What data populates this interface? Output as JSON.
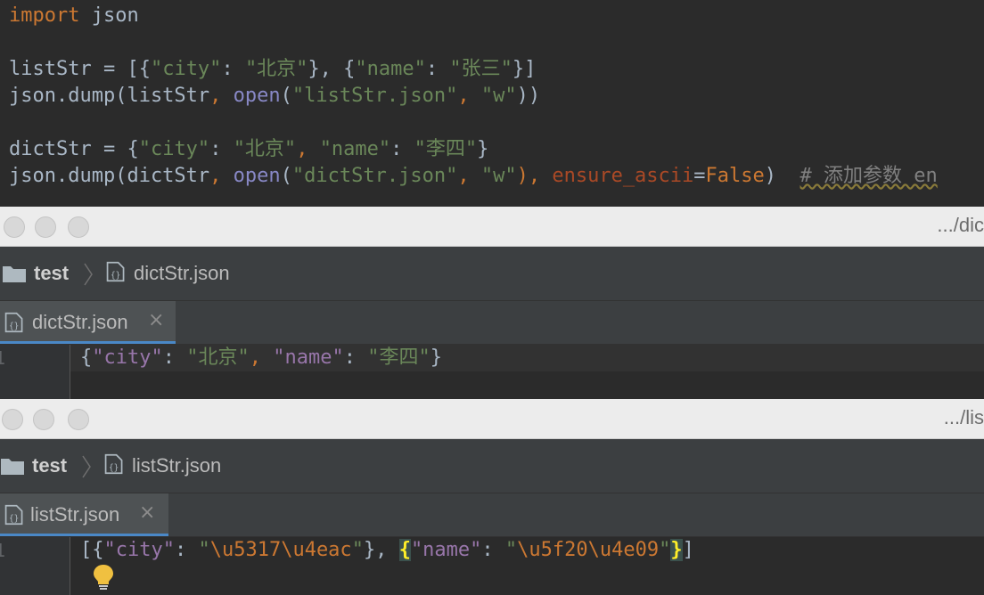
{
  "editor": {
    "lines": [
      [
        {
          "t": "import",
          "c": "kw"
        },
        {
          "t": " json",
          "c": "plain"
        }
      ],
      [],
      [
        {
          "t": "listStr = [{",
          "c": "plain"
        },
        {
          "t": "\"city\"",
          "c": "str"
        },
        {
          "t": ": ",
          "c": "plain"
        },
        {
          "t": "\"北京\"",
          "c": "str"
        },
        {
          "t": "}, {",
          "c": "plain"
        },
        {
          "t": "\"name\"",
          "c": "str"
        },
        {
          "t": ": ",
          "c": "plain"
        },
        {
          "t": "\"张三\"",
          "c": "str"
        },
        {
          "t": "}]",
          "c": "plain"
        }
      ],
      [
        {
          "t": "json.dump(listStr",
          "c": "plain"
        },
        {
          "t": ", ",
          "c": "kw"
        },
        {
          "t": "open",
          "c": "fn"
        },
        {
          "t": "(",
          "c": "plain"
        },
        {
          "t": "\"listStr.json\"",
          "c": "str"
        },
        {
          "t": ", ",
          "c": "kw"
        },
        {
          "t": "\"w\"",
          "c": "str"
        },
        {
          "t": "))",
          "c": "plain"
        }
      ],
      [],
      [
        {
          "t": "dictStr = {",
          "c": "plain"
        },
        {
          "t": "\"city\"",
          "c": "str"
        },
        {
          "t": ": ",
          "c": "plain"
        },
        {
          "t": "\"北京\"",
          "c": "str"
        },
        {
          "t": ", ",
          "c": "kw"
        },
        {
          "t": "\"name\"",
          "c": "str"
        },
        {
          "t": ": ",
          "c": "plain"
        },
        {
          "t": "\"李四\"",
          "c": "str"
        },
        {
          "t": "}",
          "c": "plain"
        }
      ],
      [
        {
          "t": "json.dump(dictStr",
          "c": "plain"
        },
        {
          "t": ", ",
          "c": "kw"
        },
        {
          "t": "open",
          "c": "fn"
        },
        {
          "t": "(",
          "c": "plain"
        },
        {
          "t": "\"dictStr.json\"",
          "c": "str"
        },
        {
          "t": ", ",
          "c": "kw"
        },
        {
          "t": "\"w\"",
          "c": "str"
        },
        {
          "t": "), ",
          "c": "kw"
        },
        {
          "t": "ensure_ascii",
          "c": "param"
        },
        {
          "t": "=",
          "c": "plain"
        },
        {
          "t": "False",
          "c": "kw"
        },
        {
          "t": ")  ",
          "c": "plain"
        },
        {
          "t": "# 添加参数 en",
          "c": "cmt squiggle"
        }
      ]
    ]
  },
  "window_dict": {
    "title_path": ".../dic",
    "nav_folder": "test",
    "nav_file": "dictStr.json",
    "tab_label": "dictStr.json",
    "tab_close": "×",
    "line_number": "1",
    "json_line": [
      {
        "t": "{",
        "c": "plain"
      },
      {
        "t": "\"city\"",
        "c": "key"
      },
      {
        "t": ": ",
        "c": "plain"
      },
      {
        "t": "\"北京\"",
        "c": "jstr"
      },
      {
        "t": ", ",
        "c": "jesc"
      },
      {
        "t": "\"name\"",
        "c": "key"
      },
      {
        "t": ": ",
        "c": "plain"
      },
      {
        "t": "\"李四\"",
        "c": "jstr"
      },
      {
        "t": "}",
        "c": "plain"
      }
    ]
  },
  "window_list": {
    "title_path": ".../lis",
    "nav_folder": "test",
    "nav_file": "listStr.json",
    "tab_label": "listStr.json",
    "tab_close": "×",
    "line_number": "1",
    "json_line": [
      {
        "t": "[{",
        "c": "plain"
      },
      {
        "t": "\"city\"",
        "c": "key"
      },
      {
        "t": ": ",
        "c": "plain"
      },
      {
        "t": "\"",
        "c": "jstr"
      },
      {
        "t": "\\u5317\\u4eac",
        "c": "jesc"
      },
      {
        "t": "\"",
        "c": "jstr"
      },
      {
        "t": "}, ",
        "c": "plain"
      },
      {
        "t": "{",
        "c": "bracehl"
      },
      {
        "t": "\"name\"",
        "c": "key"
      },
      {
        "t": ": ",
        "c": "plain"
      },
      {
        "t": "\"",
        "c": "jstr"
      },
      {
        "t": "\\u5f20\\u4e09",
        "c": "jesc"
      },
      {
        "t": "\"",
        "c": "jstr"
      },
      {
        "t": "}",
        "c": "bracehl"
      },
      {
        "t": "]",
        "c": "plain"
      }
    ]
  },
  "colors": {
    "editor_bg": "#2b2b2b",
    "keyword": "#cc7832",
    "string": "#6a8759",
    "json_key": "#9876aa",
    "builtin": "#8888c6",
    "param": "#aa4926",
    "comment": "#808080",
    "tab_underline": "#4a88c7",
    "lightbulb": "#f0c040"
  },
  "icons": {
    "folder": "folder-icon",
    "json_file": "json-file-icon",
    "chevron": "chevron-right-icon",
    "lightbulb": "lightbulb-icon",
    "close": "close-icon"
  }
}
